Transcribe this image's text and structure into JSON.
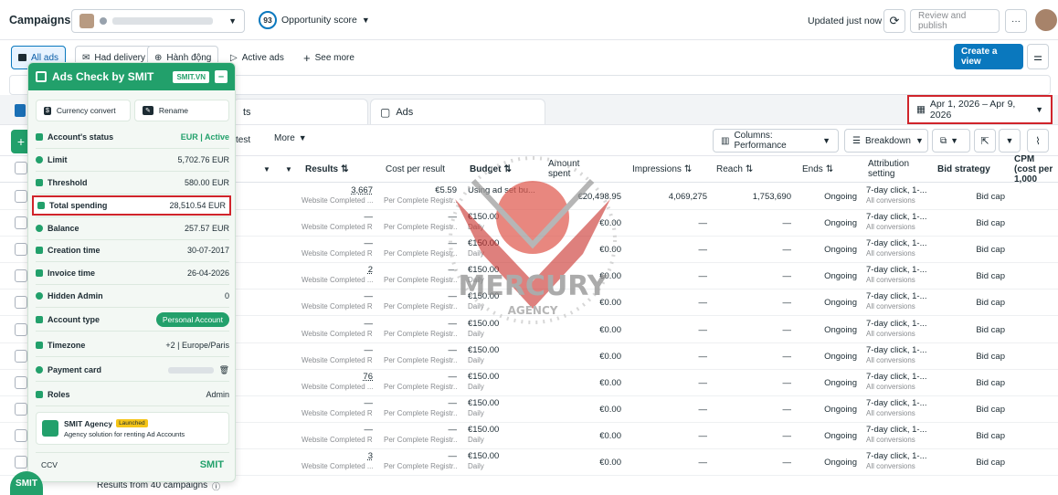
{
  "topbar": {
    "campaigns_label": "Campaigns",
    "account_name": "",
    "opportunity_score": "93",
    "opportunity_label": "Opportunity score",
    "updated_text": "Updated just now",
    "review_publish": "Review and publish",
    "more": "···"
  },
  "filters": {
    "all_ads": "All ads",
    "had_delivery": "Had delivery",
    "hanh_dong": "Hành động",
    "active_ads": "Active ads",
    "see_more": "See more",
    "create_view": "Create a view"
  },
  "tabs": {
    "ad_sets_partial": "ts",
    "ads": "Ads"
  },
  "date_range": "Apr 1, 2026 – Apr 9, 2026",
  "toolbar": {
    "test_partial": "test",
    "more": "More",
    "columns": "Columns: Performance",
    "breakdown": "Breakdown"
  },
  "columns": {
    "results": "Results",
    "cost_per_result": "Cost per result",
    "budget": "Budget",
    "amount_spent": "Amount spent",
    "impressions": "Impressions",
    "reach": "Reach",
    "ends": "Ends",
    "attribution": "Attribution setting",
    "bid_strategy": "Bid strategy",
    "cpm": "CPM (cost per 1,000"
  },
  "rows": [
    {
      "results": "3,667",
      "results_sub": "Website Completed ...",
      "cost": "€5.59",
      "cost_sub": "Per Complete Registr...",
      "budget": "Using ad set bu...",
      "budget_sub": "",
      "spent": "€20,498.95",
      "impr": "4,069,275",
      "reach": "1,753,690",
      "ends": "Ongoing",
      "attr": "7-day click, 1-...",
      "attr_sub": "All conversions",
      "bid": "Bid cap"
    },
    {
      "results": "—",
      "results_sub": "Website Completed R...",
      "cost": "—",
      "cost_sub": "Per Complete Registr...",
      "budget": "€150.00",
      "budget_sub": "Daily",
      "spent": "€0.00",
      "impr": "—",
      "reach": "—",
      "ends": "Ongoing",
      "attr": "7-day click, 1-...",
      "attr_sub": "All conversions",
      "bid": "Bid cap"
    },
    {
      "results": "—",
      "results_sub": "Website Completed R...",
      "cost": "—",
      "cost_sub": "Per Complete Registr...",
      "budget": "€150.00",
      "budget_sub": "Daily",
      "spent": "€0.00",
      "impr": "—",
      "reach": "—",
      "ends": "Ongoing",
      "attr": "7-day click, 1-...",
      "attr_sub": "All conversions",
      "bid": "Bid cap"
    },
    {
      "results": "2",
      "results_sub": "Website Completed ...",
      "cost": "—",
      "cost_sub": "Per Complete Registr...",
      "budget": "€150.00",
      "budget_sub": "Daily",
      "spent": "€0.00",
      "impr": "—",
      "reach": "—",
      "ends": "Ongoing",
      "attr": "7-day click, 1-...",
      "attr_sub": "All conversions",
      "bid": "Bid cap"
    },
    {
      "results": "—",
      "results_sub": "Website Completed R...",
      "cost": "—",
      "cost_sub": "Per Complete Registr...",
      "budget": "€150.00",
      "budget_sub": "Daily",
      "spent": "€0.00",
      "impr": "—",
      "reach": "—",
      "ends": "Ongoing",
      "attr": "7-day click, 1-...",
      "attr_sub": "All conversions",
      "bid": "Bid cap"
    },
    {
      "results": "—",
      "results_sub": "Website Completed R...",
      "cost": "—",
      "cost_sub": "Per Complete Registr...",
      "budget": "€150.00",
      "budget_sub": "Daily",
      "spent": "€0.00",
      "impr": "—",
      "reach": "—",
      "ends": "Ongoing",
      "attr": "7-day click, 1-...",
      "attr_sub": "All conversions",
      "bid": "Bid cap"
    },
    {
      "results": "—",
      "results_sub": "Website Completed R...",
      "cost": "—",
      "cost_sub": "Per Complete Registr...",
      "budget": "€150.00",
      "budget_sub": "Daily",
      "spent": "€0.00",
      "impr": "—",
      "reach": "—",
      "ends": "Ongoing",
      "attr": "7-day click, 1-...",
      "attr_sub": "All conversions",
      "bid": "Bid cap"
    },
    {
      "results": "76",
      "results_sub": "Website Completed ...",
      "cost": "—",
      "cost_sub": "Per Complete Registr...",
      "budget": "€150.00",
      "budget_sub": "Daily",
      "spent": "€0.00",
      "impr": "—",
      "reach": "—",
      "ends": "Ongoing",
      "attr": "7-day click, 1-...",
      "attr_sub": "All conversions",
      "bid": "Bid cap"
    },
    {
      "results": "—",
      "results_sub": "Website Completed R...",
      "cost": "—",
      "cost_sub": "Per Complete Registr...",
      "budget": "€150.00",
      "budget_sub": "Daily",
      "spent": "€0.00",
      "impr": "—",
      "reach": "—",
      "ends": "Ongoing",
      "attr": "7-day click, 1-...",
      "attr_sub": "All conversions",
      "bid": "Bid cap"
    },
    {
      "results": "—",
      "results_sub": "Website Completed R...",
      "cost": "—",
      "cost_sub": "Per Complete Registr...",
      "budget": "€150.00",
      "budget_sub": "Daily",
      "spent": "€0.00",
      "impr": "—",
      "reach": "—",
      "ends": "Ongoing",
      "attr": "7-day click, 1-...",
      "attr_sub": "All conversions",
      "bid": "Bid cap"
    },
    {
      "results": "3",
      "results_sub": "Website Completed ...",
      "cost": "—",
      "cost_sub": "Per Complete Registr...",
      "budget": "€150.00",
      "budget_sub": "Daily",
      "spent": "€0.00",
      "impr": "—",
      "reach": "—",
      "ends": "Ongoing",
      "attr": "7-day click, 1-...",
      "attr_sub": "All conversions",
      "bid": "Bid cap"
    }
  ],
  "footer": {
    "results_from": "Results from 40 campaigns"
  },
  "smit": {
    "title": "Ads Check by SMIT",
    "badge": "SMIT.VN",
    "currency_convert": "Currency convert",
    "rename": "Rename",
    "items": [
      {
        "key": "Account's status",
        "value": "EUR | Active"
      },
      {
        "key": "Limit",
        "value": "5,702.76 EUR"
      },
      {
        "key": "Threshold",
        "value": "580.00 EUR"
      },
      {
        "key": "Total spending",
        "value": "28,510.54 EUR"
      },
      {
        "key": "Balance",
        "value": "257.57 EUR"
      },
      {
        "key": "Creation time",
        "value": "30-07-2017"
      },
      {
        "key": "Invoice time",
        "value": "26-04-2026"
      },
      {
        "key": "Hidden Admin",
        "value": "0"
      },
      {
        "key": "Account type",
        "value": "Personal Account"
      },
      {
        "key": "Timezone",
        "value": "+2 | Europe/Paris"
      },
      {
        "key": "Payment card",
        "value": ""
      },
      {
        "key": "Roles",
        "value": "Admin"
      }
    ],
    "agency_title": "SMIT Agency",
    "agency_badge": "Launched",
    "agency_desc": "Agency solution for renting Ad Accounts",
    "ccv": "CCV",
    "brand": "SMIT",
    "fab": "SMIT"
  },
  "watermark": {
    "line1": "MERCURY",
    "line2": "AGENCY"
  },
  "colors": {
    "accent": "#0a78be",
    "smit_green": "#22a06b",
    "highlight_red": "#d0242b"
  }
}
